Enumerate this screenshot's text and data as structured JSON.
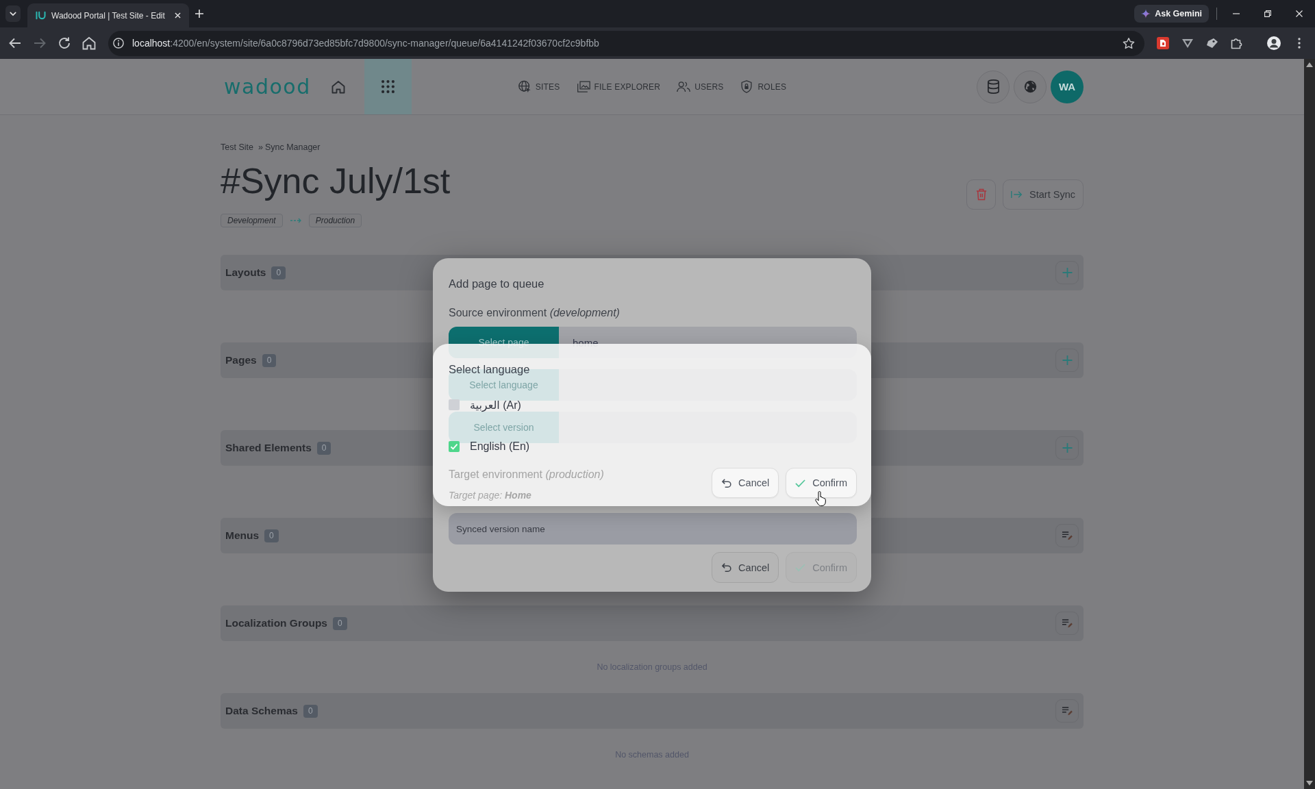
{
  "browser": {
    "tabs": [
      {
        "title": "Wadood Portal | Test Site - Edit",
        "selected": true
      }
    ],
    "ask_gemini": "Ask Gemini",
    "nav_buttons": [
      {
        "kind": "back",
        "disabled": false
      },
      {
        "kind": "forward",
        "disabled": true
      },
      {
        "kind": "reload",
        "disabled": false
      },
      {
        "kind": "home",
        "disabled": false
      }
    ],
    "url": {
      "host": "localhost",
      "path": ":4200/en/system/site/6a0c8796d73ed85bfc7d9800/sync-manager/queue/6a4141242f03670cf2c9bfbb"
    }
  },
  "header": {
    "logo": "wadood",
    "apps_button": {
      "highlighted": true
    },
    "nav": [
      {
        "label": "SITES",
        "kind": "sites"
      },
      {
        "label": "FILE EXPLORER",
        "kind": "files"
      },
      {
        "label": "USERS",
        "kind": "users"
      },
      {
        "label": "ROLES",
        "kind": "roles"
      }
    ],
    "avatar": "WA"
  },
  "page": {
    "breadcrumb": {
      "items": [
        "Test Site",
        "Sync Manager"
      ],
      "separator": "»"
    },
    "title": "#Sync July/1st",
    "source_env": "Development",
    "target_env": "Production",
    "start_button": "Start Sync"
  },
  "sections": [
    {
      "title": "Layouts",
      "count": "0",
      "kind": "add"
    },
    {
      "title": "Pages",
      "count": "0",
      "kind": "add"
    },
    {
      "title": "Shared Elements",
      "count": "0",
      "kind": "add"
    },
    {
      "title": "Menus",
      "count": "0",
      "kind": "list"
    },
    {
      "title": "Localization Groups",
      "count": "0",
      "kind": "list",
      "empty_text": "No localization groups added"
    },
    {
      "title": "Data Schemas",
      "count": "0",
      "kind": "list",
      "empty_text": "No schemas added"
    }
  ],
  "modal": {
    "title": "Add page to queue",
    "source_label": "Source environment *(development)*",
    "pickers": [
      {
        "button": "Select page",
        "value": "home"
      },
      {
        "button": "Select language"
      },
      {
        "button": "Select version"
      }
    ],
    "target_label": "Target environment *(production)*",
    "target_page": "Target page: **Home**",
    "version_name": {
      "placeholder": "Synced version name"
    },
    "buttons": [
      {
        "label": "Cancel",
        "kind": "cancel",
        "disabled": false
      },
      {
        "label": "Confirm",
        "kind": "confirm",
        "disabled": true
      }
    ]
  },
  "language_popup": {
    "title": "Select language",
    "languages": [
      {
        "label": "العربية (Ar)",
        "checked": false
      },
      {
        "label": "English (En)",
        "checked": true
      }
    ],
    "buttons": [
      {
        "label": "Cancel",
        "kind": "cancel",
        "disabled": false
      },
      {
        "label": "Confirm",
        "kind": "confirm",
        "disabled": false
      }
    ]
  }
}
